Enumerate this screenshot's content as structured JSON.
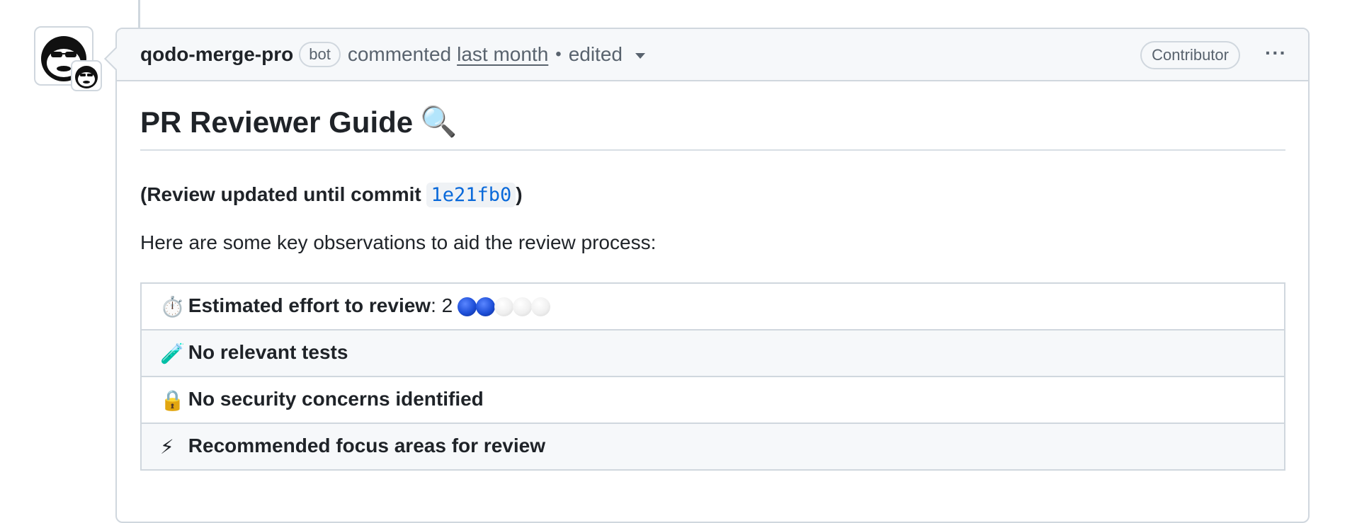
{
  "comment": {
    "author": "qodo-merge-pro",
    "badge": "bot",
    "action": "commented",
    "time": "last month",
    "separator": "•",
    "edited": "edited",
    "role": "Contributor",
    "more": "···"
  },
  "content": {
    "title": "PR Reviewer Guide",
    "title_icon": "🔍",
    "review_prefix": "(Review updated until commit ",
    "commit": "1e21fb0",
    "review_suffix": ")",
    "intro": "Here are some key observations to aid the review process:"
  },
  "rows": [
    {
      "icon": "⏱️",
      "icon_name": "stopwatch-icon",
      "label": "Estimated effort to review",
      "value": ": 2",
      "effort": {
        "filled": 2,
        "total": 5
      }
    },
    {
      "icon": "🧪",
      "icon_name": "test-tube-icon",
      "label": "No relevant tests"
    },
    {
      "icon": "🔒",
      "icon_name": "lock-icon",
      "label": "No security concerns identified"
    },
    {
      "icon": "⚡",
      "icon_name": "lightning-icon",
      "label": "Recommended focus areas for review"
    }
  ],
  "colors": {
    "link": "#0969da",
    "border": "#d0d7de",
    "header_bg": "#f6f8fa"
  }
}
